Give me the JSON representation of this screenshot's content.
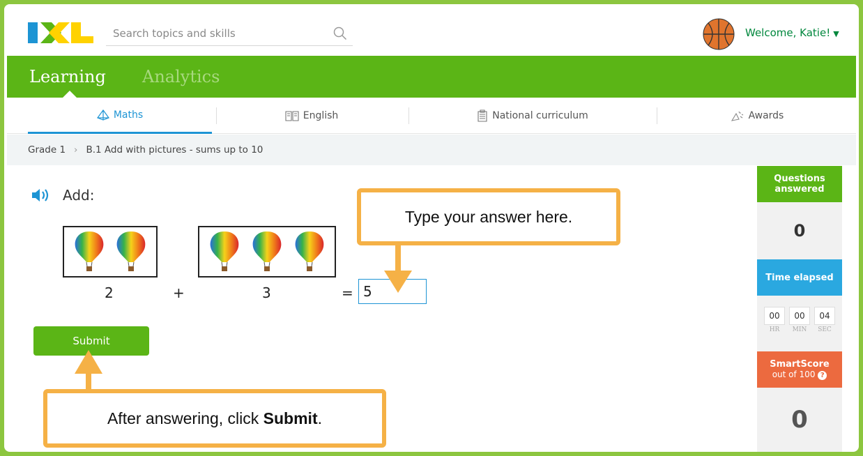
{
  "header": {
    "logo_text": "IXL",
    "search_placeholder": "Search topics and skills",
    "welcome": "Welcome, Katie!"
  },
  "mainnav": {
    "tabs": [
      {
        "label": "Learning"
      },
      {
        "label": "Analytics"
      }
    ]
  },
  "subjects": [
    {
      "label": "Maths"
    },
    {
      "label": "English"
    },
    {
      "label": "National curriculum"
    },
    {
      "label": "Awards"
    }
  ],
  "breadcrumb": {
    "grade": "Grade 1",
    "skill": "B.1 Add with pictures - sums up to 10"
  },
  "question": {
    "prompt": "Add:",
    "addend1": "2",
    "plus": "+",
    "addend2": "3",
    "equals": "=",
    "answer": "5",
    "submit_label": "Submit"
  },
  "callouts": {
    "top": "Type your answer here.",
    "bottom_prefix": "After answering, click ",
    "bottom_bold": "Submit",
    "bottom_suffix": "."
  },
  "sidebar": {
    "questions_answered_label": "Questions answered",
    "questions_answered_value": "0",
    "time_elapsed_label": "Time elapsed",
    "time": {
      "hr": "00",
      "min": "00",
      "sec": "04"
    },
    "time_units": {
      "hr": "HR",
      "min": "MIN",
      "sec": "SEC"
    },
    "smartscore_label": "SmartScore",
    "smartscore_sub": "out of 100",
    "smartscore_value": "0"
  },
  "colors": {
    "green": "#5bb516",
    "blue": "#1d94d4",
    "orange": "#f5b146",
    "smartscore": "#ec6a3f"
  }
}
